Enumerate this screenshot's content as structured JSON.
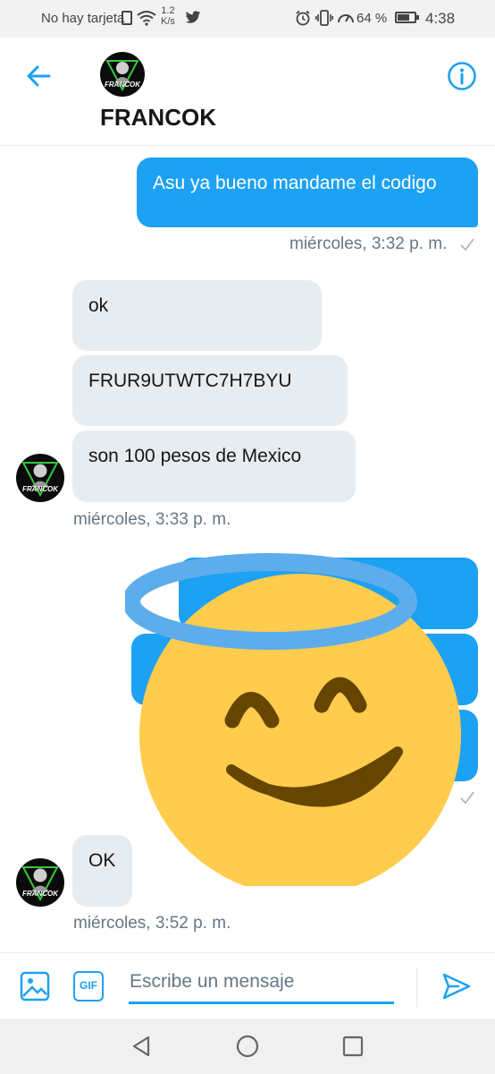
{
  "status_bar": {
    "carrier": "No hay tarjeta",
    "speed_value": "1.2",
    "speed_unit": "K/s",
    "battery": "64 %",
    "time": "4:38"
  },
  "header": {
    "contact_name": "FRANCOK",
    "avatar_text": "FRANCOK"
  },
  "messages": [
    {
      "text": "Asu ya bueno mandame el codigo"
    },
    {
      "text": "ok"
    },
    {
      "text": "FRUR9UTWTC7H7BYU"
    },
    {
      "text": "son 100 pesos de Mexico"
    },
    {
      "text": "OK"
    }
  ],
  "timestamps": {
    "t1": "miércoles, 3:32 p. m.",
    "t2": "miércoles, 3:33 p. m.",
    "t3": "miércoles, 3:52 p. m."
  },
  "composer": {
    "placeholder": "Escribe un mensaje",
    "gif_label": "GIF"
  },
  "colors": {
    "accent": "#1da1f2",
    "received_bubble": "#e6ecf0",
    "emoji_face": "#ffcc4d",
    "emoji_halo": "#5dadec"
  },
  "icons": [
    "back-arrow-icon",
    "info-icon",
    "image-icon",
    "gif-icon",
    "send-icon",
    "wifi-icon",
    "twitter-icon",
    "alarm-icon",
    "vibrate-icon",
    "battery-icon"
  ]
}
